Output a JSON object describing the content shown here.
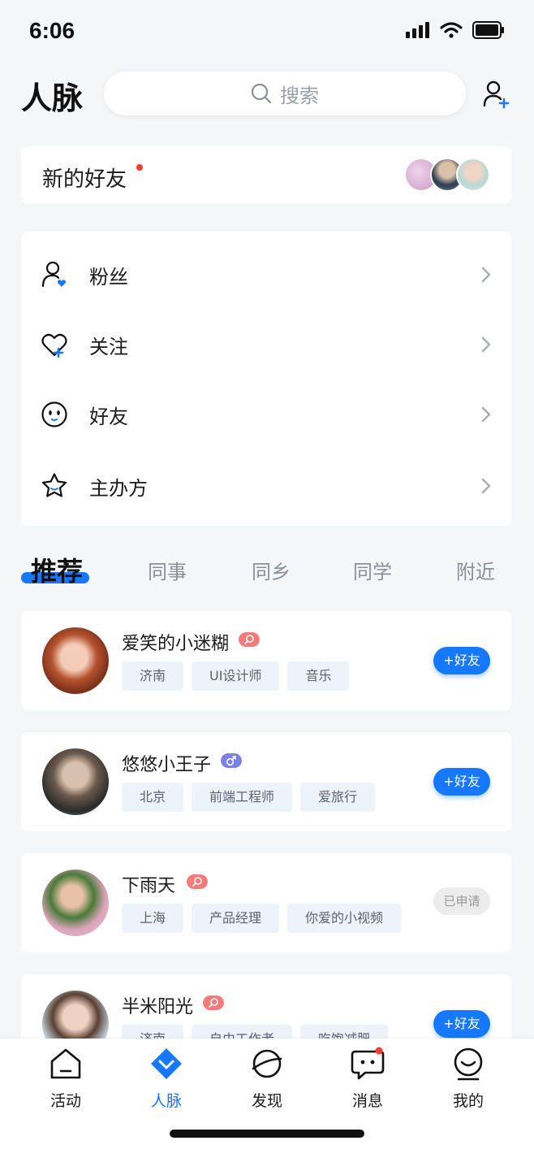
{
  "status_bar": {
    "time": "6:06"
  },
  "header": {
    "title": "人脉",
    "search_placeholder": "搜索"
  },
  "new_friends": {
    "label": "新的好友"
  },
  "menu": [
    {
      "label": "粉丝",
      "icon": "user-heart-icon"
    },
    {
      "label": "关注",
      "icon": "heart-plus-icon"
    },
    {
      "label": "好友",
      "icon": "smiley-icon"
    },
    {
      "label": "主办方",
      "icon": "star-icon"
    }
  ],
  "tabs": [
    "推荐",
    "同事",
    "同乡",
    "同学",
    "附近"
  ],
  "recommendations": [
    {
      "name": "爱笑的小迷糊",
      "badge": "female-badge",
      "tags": [
        "济南",
        "UI设计师",
        "音乐"
      ],
      "action": "+好友",
      "applied": false
    },
    {
      "name": "悠悠小王子",
      "badge": "male-badge",
      "tags": [
        "北京",
        "前端工程师",
        "爱旅行"
      ],
      "action": "+好友",
      "applied": false
    },
    {
      "name": "下雨天",
      "badge": "female-badge",
      "tags": [
        "上海",
        "产品经理",
        "你爱的小视频"
      ],
      "action": "已申请",
      "applied": true
    },
    {
      "name": "半米阳光",
      "badge": "female-badge",
      "tags": [
        "济南",
        "自由工作者",
        "吃饱减肥"
      ],
      "action": "+好友",
      "applied": false
    }
  ],
  "tabbar": [
    {
      "label": "活动",
      "icon": "home-icon",
      "active": false
    },
    {
      "label": "人脉",
      "icon": "contacts-icon",
      "active": true
    },
    {
      "label": "发现",
      "icon": "planet-icon",
      "active": false
    },
    {
      "label": "消息",
      "icon": "message-icon",
      "active": false
    },
    {
      "label": "我的",
      "icon": "profile-icon",
      "active": false
    }
  ],
  "colors": {
    "accent": "#1677ff",
    "female_badge": "#f57a7a",
    "male_badge": "#7b7fe6",
    "dot": "#ff3b30"
  }
}
